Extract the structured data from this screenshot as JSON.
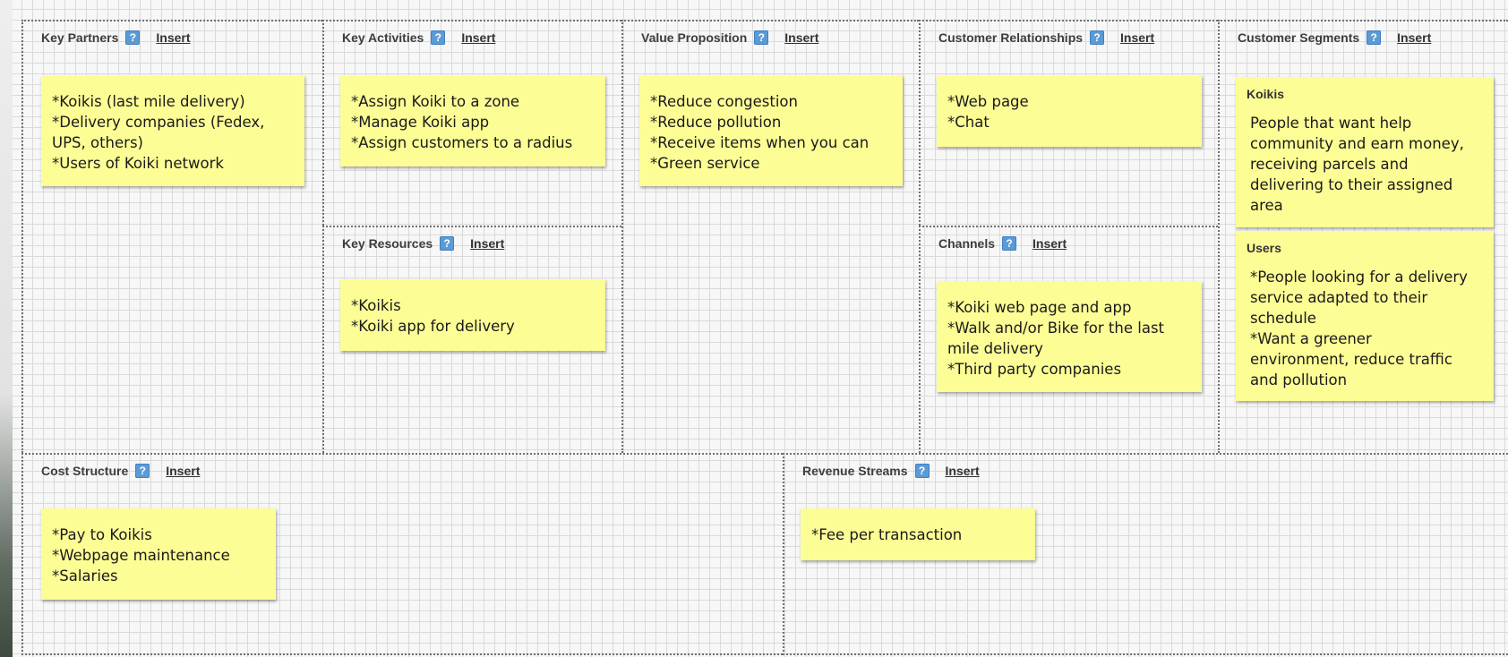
{
  "canvas": {
    "key_partners": {
      "title": "Key Partners",
      "help": "?",
      "insert": "Insert",
      "notes": [
        {
          "lines": [
            "*Koikis (last mile delivery)",
            "*Delivery companies (Fedex,",
            "UPS, others)",
            "*Users of Koiki network"
          ]
        }
      ]
    },
    "key_activities": {
      "title": "Key Activities",
      "help": "?",
      "insert": "Insert",
      "notes": [
        {
          "lines": [
            "*Assign Koiki to a zone",
            "*Manage Koiki app",
            "*Assign customers to a radius"
          ]
        }
      ]
    },
    "key_resources": {
      "title": "Key Resources",
      "help": "?",
      "insert": "Insert",
      "notes": [
        {
          "lines": [
            "*Koikis",
            "*Koiki app for delivery"
          ]
        }
      ]
    },
    "value_proposition": {
      "title": "Value Proposition",
      "help": "?",
      "insert": "Insert",
      "notes": [
        {
          "lines": [
            "*Reduce congestion",
            "*Reduce pollution",
            "*Receive items when you can",
            "*Green service"
          ]
        }
      ]
    },
    "customer_relationships": {
      "title": "Customer Relationships",
      "help": "?",
      "insert": "Insert",
      "notes": [
        {
          "lines": [
            "*Web page",
            "*Chat"
          ]
        }
      ]
    },
    "channels": {
      "title": "Channels",
      "help": "?",
      "insert": "Insert",
      "notes": [
        {
          "lines": [
            "*Koiki web page and app",
            "*Walk and/or Bike for the last",
            "mile delivery",
            "*Third party companies"
          ]
        }
      ]
    },
    "customer_segments": {
      "title": "Customer Segments",
      "help": "?",
      "insert": "Insert",
      "notes": [
        {
          "title": "Koikis",
          "lines": [
            "People that want help",
            "community and earn money,",
            "receiving parcels and",
            "delivering to their assigned",
            "area"
          ]
        },
        {
          "title": "Users",
          "lines": [
            "*People looking for a delivery",
            "service adapted to their",
            "schedule",
            "*Want a greener",
            "environment, reduce traffic",
            "and pollution"
          ]
        }
      ]
    },
    "cost_structure": {
      "title": "Cost Structure",
      "help": "?",
      "insert": "Insert",
      "notes": [
        {
          "lines": [
            "*Pay to Koikis",
            "*Webpage maintenance",
            "*Salaries"
          ]
        }
      ]
    },
    "revenue_streams": {
      "title": "Revenue Streams",
      "help": "?",
      "insert": "Insert",
      "notes": [
        {
          "lines": [
            "*Fee per transaction"
          ]
        }
      ]
    }
  },
  "colors": {
    "note": "#fdfd96",
    "help_icon": "#5b9bd5",
    "grid": "#dadada",
    "dotted_border": "#6f6f6f"
  }
}
